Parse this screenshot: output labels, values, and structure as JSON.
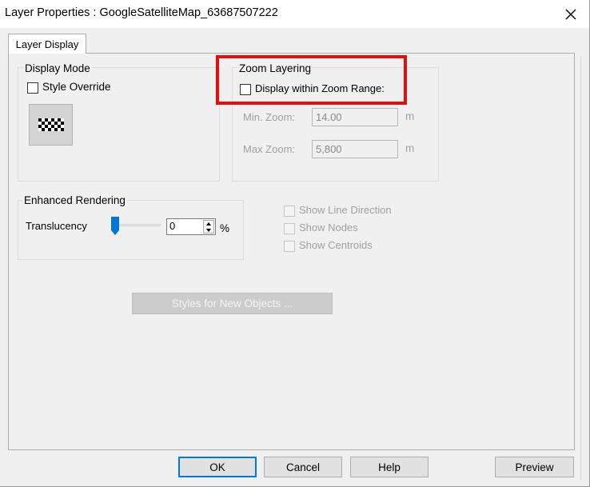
{
  "window": {
    "title": "Layer Properties  : GoogleSatelliteMap_63687507222"
  },
  "tabs": [
    {
      "label": "Layer Display",
      "selected": true
    }
  ],
  "display_mode": {
    "title": "Display Mode",
    "style_override_label": "Style Override",
    "style_override_checked": false
  },
  "zoom_layering": {
    "title": "Zoom Layering",
    "display_within_zoom_range_label": "Display within Zoom Range:",
    "display_within_zoom_range_checked": false,
    "min_zoom_label": "Min. Zoom:",
    "min_zoom_value": "14.00",
    "min_zoom_unit": "m",
    "max_zoom_label": "Max Zoom:",
    "max_zoom_value": "5,800",
    "max_zoom_unit": "m"
  },
  "enhanced_rendering": {
    "title": "Enhanced Rendering",
    "translucency_label": "Translucency",
    "translucency_value": "0",
    "translucency_unit": "%"
  },
  "options": {
    "show_line_direction": "Show Line Direction",
    "show_nodes": "Show Nodes",
    "show_centroids": "Show Centroids"
  },
  "styles_button_label": "Styles for New Objects ...",
  "footer_buttons": {
    "ok": "OK",
    "cancel": "Cancel",
    "help": "Help",
    "preview": "Preview"
  },
  "colors": {
    "highlight": "#e01010",
    "default_button_border": "#0078d7",
    "slider_thumb": "#0078d7"
  },
  "icons": {
    "close": "close-icon",
    "style_preview": "checker-pattern-icon",
    "spin_up": "spin-up-icon",
    "spin_down": "spin-down-icon"
  }
}
